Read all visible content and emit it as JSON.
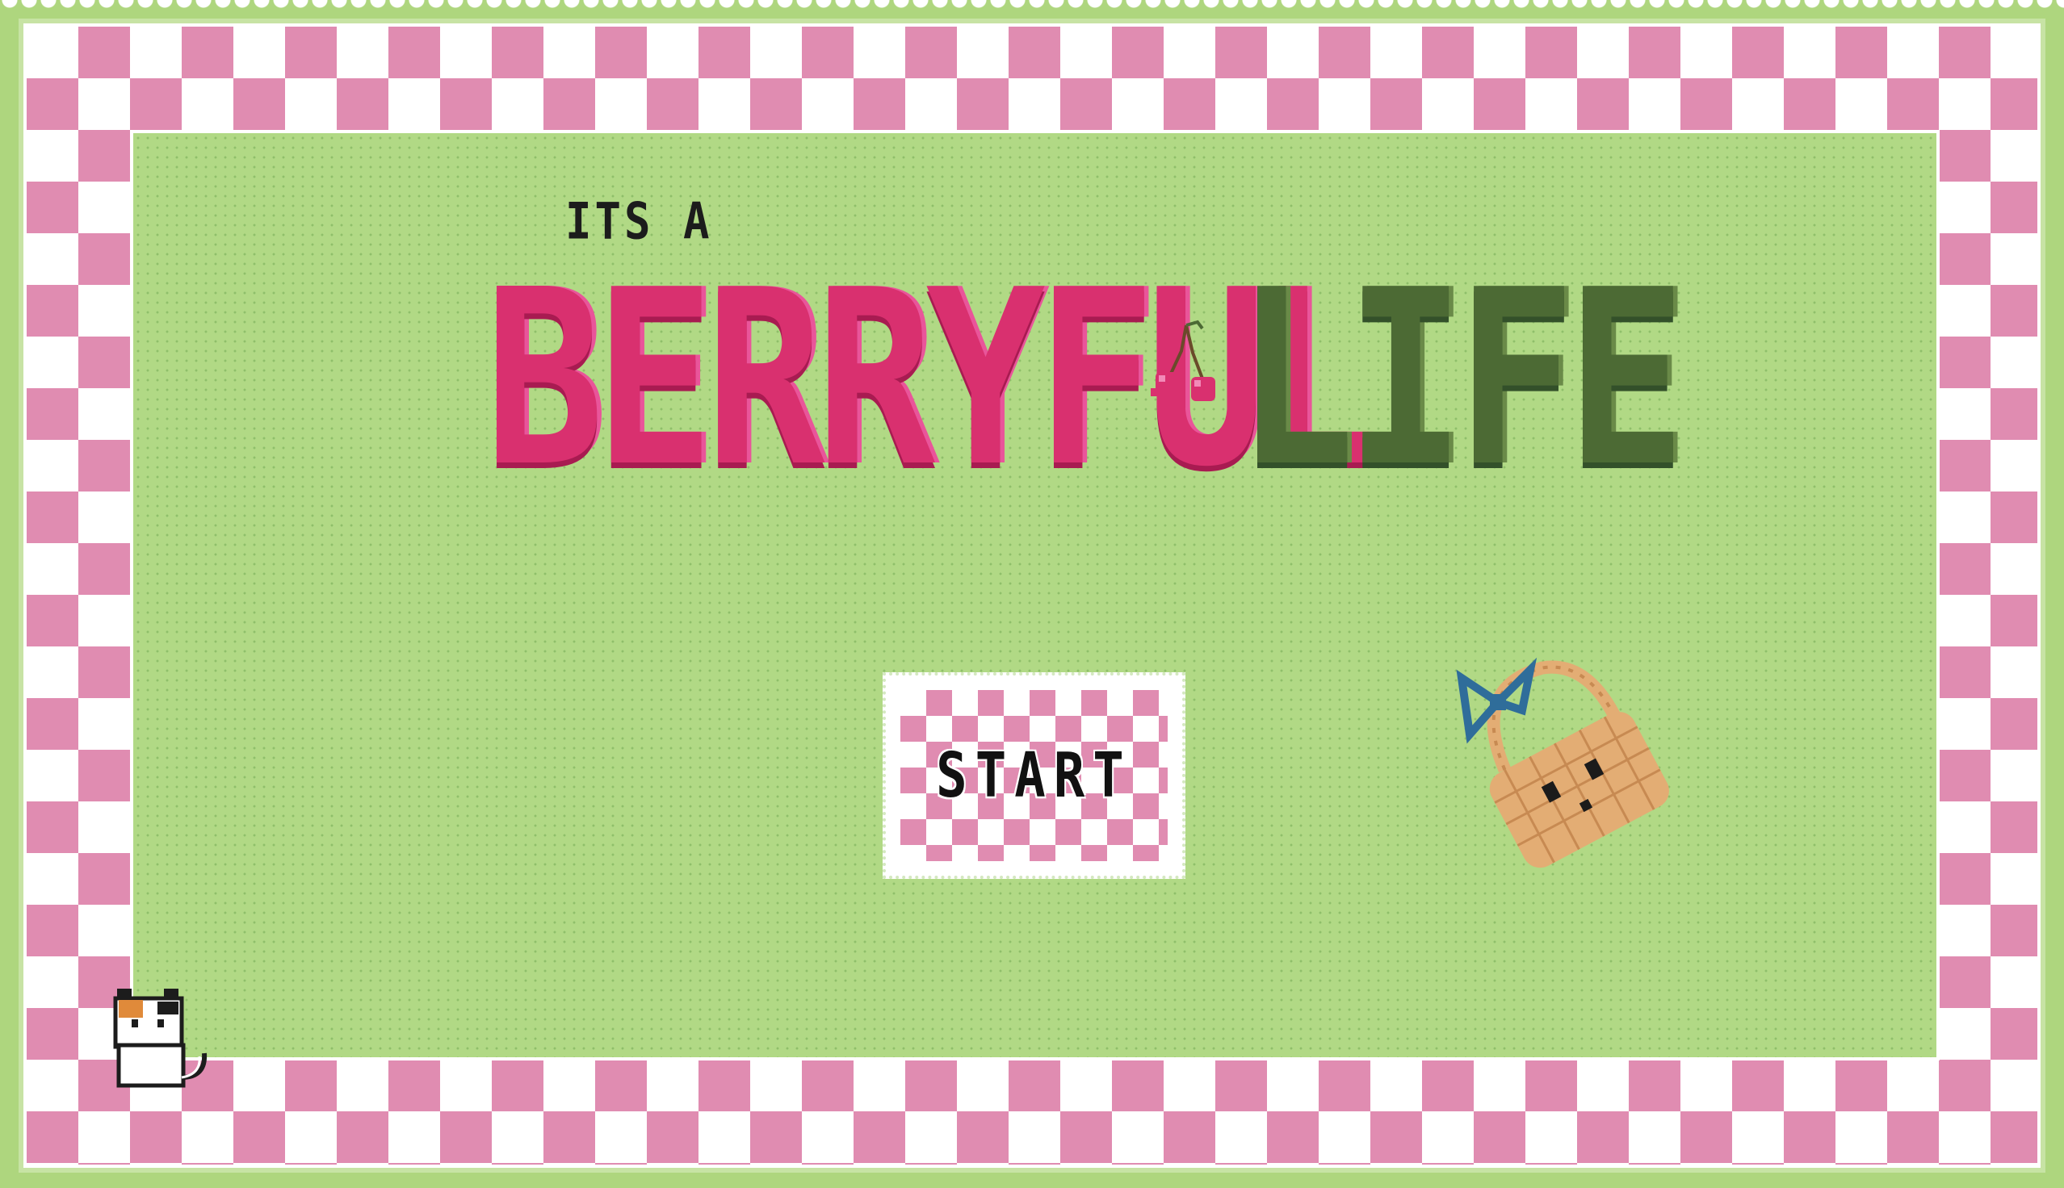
{
  "title": {
    "subtitle": "ITS A",
    "word1": "BERRYFUL",
    "word2": "LIFE"
  },
  "menu": {
    "start_label": "START"
  },
  "colors": {
    "background_green": "#b1d985",
    "checker_pink": "#e08cb1",
    "title_pink": "#d9306f",
    "title_green": "#4c6a34",
    "basket_tan": "#e3ad74",
    "ribbon_blue": "#2f6d9a"
  },
  "icons": {
    "cherry": "cherry-icon",
    "basket": "basket-icon",
    "cat": "cat-icon"
  }
}
